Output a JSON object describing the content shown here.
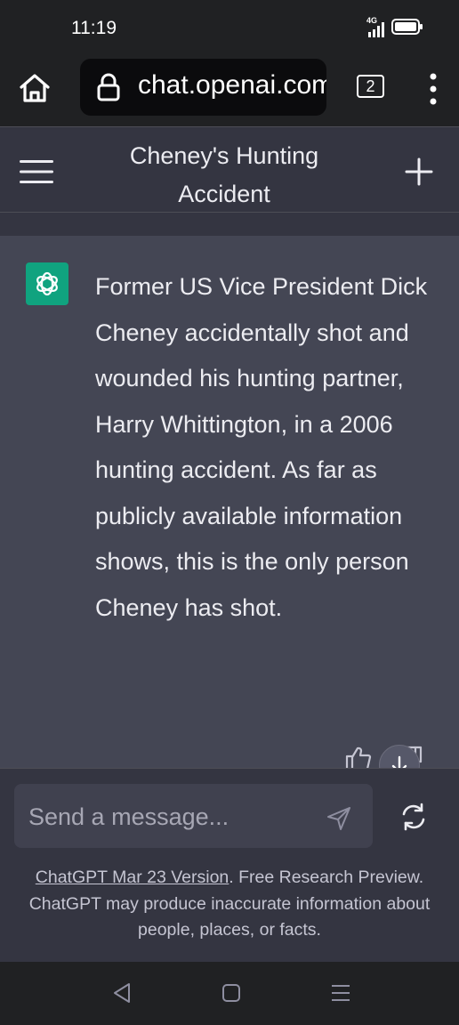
{
  "status_bar": {
    "time": "11:19",
    "network": "4G",
    "icons": [
      "signal-icon",
      "battery-icon"
    ]
  },
  "browser": {
    "url": "chat.openai.com",
    "tab_count": "2",
    "icons": [
      "home-icon",
      "lock-icon",
      "tabs-icon",
      "more-vert-icon"
    ]
  },
  "chat": {
    "title": "Cheney's Hunting Accident",
    "icons": [
      "hamburger-menu-icon",
      "new-chat-plus-icon"
    ],
    "message": {
      "role": "assistant",
      "text": "Former US Vice President Dick Cheney accidentally shot and wounded his hunting partner, Harry Whittington, in a 2006 hunting accident. As far as publicly available information shows, this is the only person Cheney has shot."
    }
  },
  "composer": {
    "placeholder": "Send a message...",
    "footer_link": "ChatGPT Mar 23 Version",
    "footer_text": ". Free Research Preview. ChatGPT may produce inaccurate information about people, places, or facts."
  },
  "colors": {
    "background": "#343541",
    "message_background": "#444654",
    "brand_green": "#10a37f",
    "toolbar": "#202123",
    "input_background": "#40414f"
  }
}
